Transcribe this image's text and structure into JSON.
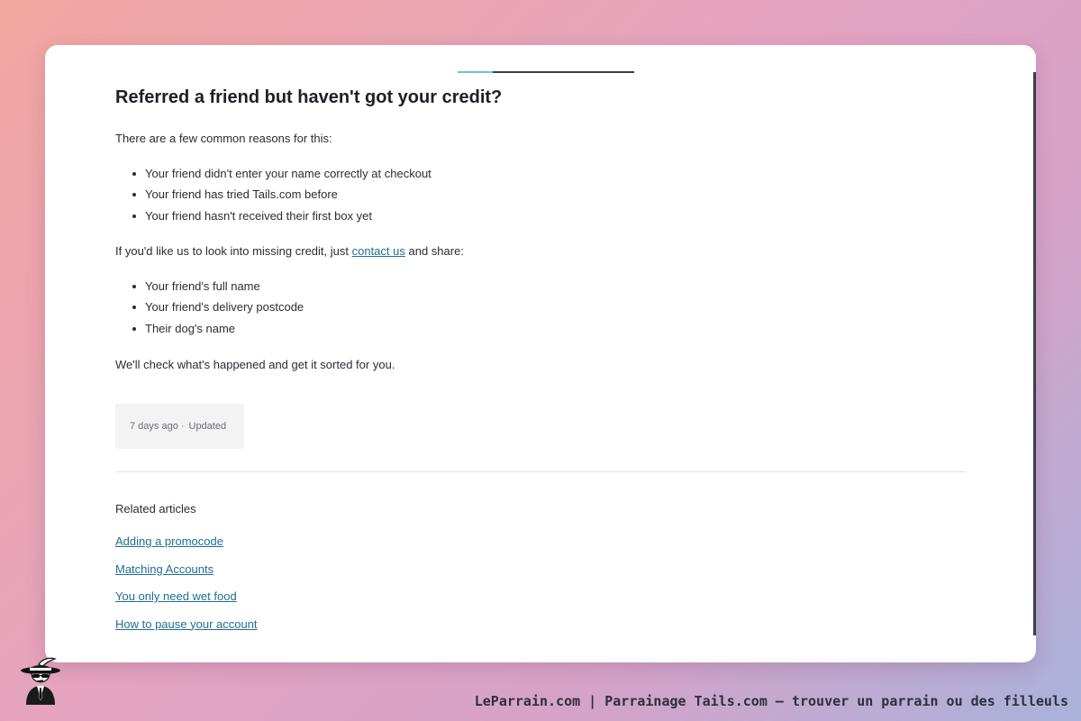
{
  "article": {
    "title": "Referred a friend but haven't got your credit?",
    "intro": "There are a few common reasons for this:",
    "reasons": [
      "Your friend didn't enter your name correctly at checkout",
      "Your friend has tried Tails.com before",
      "Your friend hasn't received their first box yet"
    ],
    "contact_prefix": "If you'd like us to look into missing credit, just ",
    "contact_link": "contact us",
    "contact_suffix": " and share:",
    "details": [
      "Your friend's full name",
      "Your friend's delivery postcode",
      "Their dog's name"
    ],
    "closing": "We'll check what's happened and get it sorted for you.",
    "reading_progress": 0.2
  },
  "meta": {
    "age": "7 days ago",
    "separator": "·",
    "status": "Updated"
  },
  "related": {
    "title": "Related articles",
    "links": [
      "Adding a promocode",
      "Matching Accounts",
      "You only need wet food",
      "How to pause your account"
    ]
  },
  "footer": {
    "caption": "LeParrain.com | Parrainage Tails.com — trouver un parrain ou des filleuls",
    "logo_icon": "gangster-mascot-icon"
  },
  "colors": {
    "link": "#1f6e93",
    "progress_fill": "#6fc3dc",
    "progress_track": "#3c3f46"
  }
}
